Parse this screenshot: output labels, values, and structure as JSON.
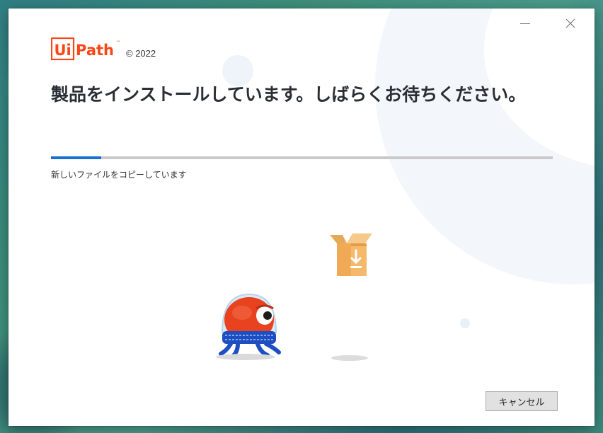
{
  "app": {
    "logo_text": "UiPath",
    "copyright": "© 2022"
  },
  "window_controls": {
    "minimize_icon": "minimize-icon",
    "close_icon": "close-icon"
  },
  "installer": {
    "heading": "製品をインストールしています。しばらくお待ちください。",
    "progress_fraction": 0.1,
    "status_text": "新しいファイルをコピーしています"
  },
  "buttons": {
    "cancel_label": "キャンセル"
  },
  "icons": {
    "box": "download-box-icon",
    "mascot": "robot-mascot-illustration"
  },
  "colors": {
    "brand": "#fa4616",
    "progress": "#1d6fcf",
    "track": "#c9c9c9"
  }
}
